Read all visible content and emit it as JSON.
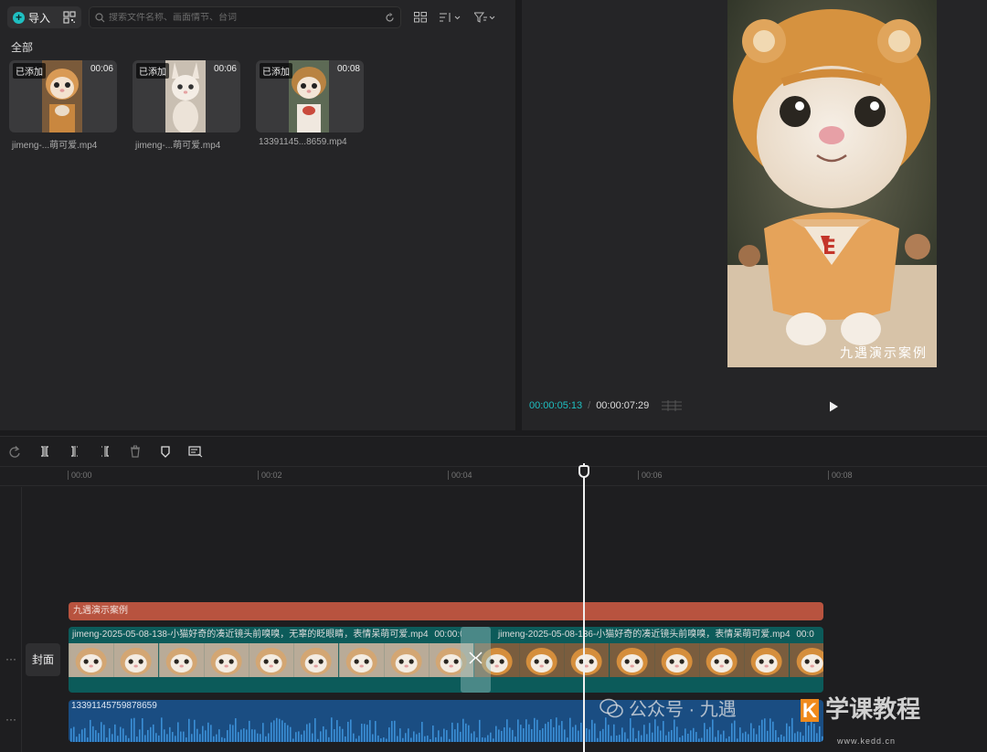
{
  "media": {
    "import_label": "导入",
    "search_placeholder": "搜索文件名称、画面情节、台词",
    "all_label": "全部",
    "items": [
      {
        "tag": "已添加",
        "duration": "00:06",
        "name": "jimeng-...萌可爱.mp4"
      },
      {
        "tag": "已添加",
        "duration": "00:06",
        "name": "jimeng-...萌可爱.mp4"
      },
      {
        "tag": "已添加",
        "duration": "00:08",
        "name": "13391145...8659.mp4"
      }
    ]
  },
  "preview": {
    "watermark": "九遇演示案例",
    "current_time": "00:00:05:13",
    "separator": "/",
    "total_time": "00:00:07:29"
  },
  "timeline": {
    "ruler": [
      "00:00",
      "00:02",
      "00:04",
      "00:06",
      "00:08"
    ],
    "cover_label": "封面",
    "text_clip": "九遇演示案例",
    "video_clip_1": "jimeng-2025-05-08-138-小猫好奇的凑近镜头前嗅嗅，无辜的眨眼睛，表情呆萌可爱.mp4",
    "video_clip_1_time": "00:00:0",
    "video_clip_2": "jimeng-2025-05-08-136-小猫好奇的凑近镜头前嗅嗅，表情呆萌可爱.mp4",
    "video_clip_2_time": "00:0",
    "audio_clip": "13391145759878659",
    "progress_fraction": 0.687
  },
  "overlay": {
    "wechat_text": "公众号 · 九遇",
    "brand_text": "学课教程",
    "brand_url": "www.kedd.cn"
  },
  "colors": {
    "accent": "#1fbfc1",
    "text_track": "#b8533f",
    "video_track": "#0c5b5a",
    "audio_track": "#1a4d82"
  }
}
